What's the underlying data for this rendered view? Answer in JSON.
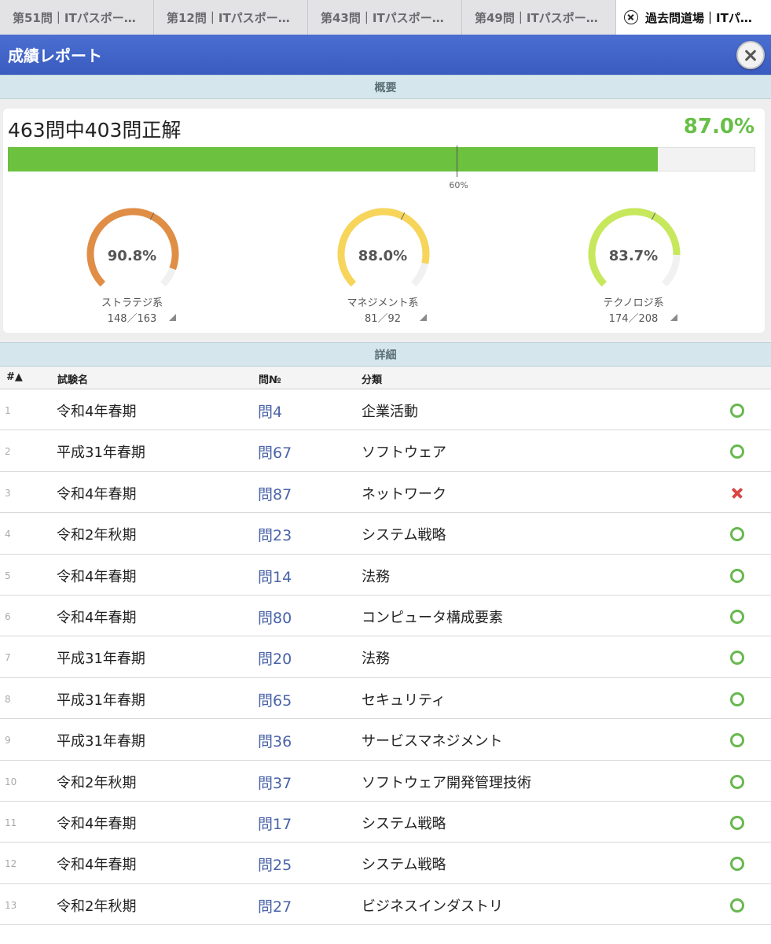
{
  "tabs": [
    {
      "label": "第51問｜ITパスポー…"
    },
    {
      "label": "第12問｜ITパスポー…"
    },
    {
      "label": "第43問｜ITパスポー…"
    },
    {
      "label": "第49問｜ITパスポー…"
    },
    {
      "label": "過去問道場｜ITパ…",
      "active": true
    }
  ],
  "header": {
    "title": "成績レポート"
  },
  "summary": {
    "section_label": "概要",
    "score_text": "463問中403問正解",
    "score_percent": "87.0%",
    "progress": 0.87,
    "pass_line": 0.6,
    "pass_line_label": "60%",
    "colors": {
      "bar": "#6cc13f",
      "percent": "#67bf46"
    }
  },
  "gauges": [
    {
      "pct_label": "90.8%",
      "value": 0.908,
      "name": "ストラテジ系",
      "count": "148／163",
      "color": "#e08d45"
    },
    {
      "pct_label": "88.0%",
      "value": 0.88,
      "name": "マネジメント系",
      "count": "81／92",
      "color": "#f6d55a"
    },
    {
      "pct_label": "83.7%",
      "value": 0.837,
      "name": "テクノロジ系",
      "count": "174／208",
      "color": "#c7e85c"
    }
  ],
  "details": {
    "section_label": "詳細",
    "columns": {
      "num": "#▲",
      "exam": "試験名",
      "q": "問№",
      "cat": "分類"
    },
    "rows": [
      {
        "num": "1",
        "exam": "令和4年春期",
        "q": "問4",
        "cat": "企業活動",
        "result": "correct"
      },
      {
        "num": "2",
        "exam": "平成31年春期",
        "q": "問67",
        "cat": "ソフトウェア",
        "result": "correct"
      },
      {
        "num": "3",
        "exam": "令和4年春期",
        "q": "問87",
        "cat": "ネットワーク",
        "result": "wrong"
      },
      {
        "num": "4",
        "exam": "令和2年秋期",
        "q": "問23",
        "cat": "システム戦略",
        "result": "correct"
      },
      {
        "num": "5",
        "exam": "令和4年春期",
        "q": "問14",
        "cat": "法務",
        "result": "correct"
      },
      {
        "num": "6",
        "exam": "令和4年春期",
        "q": "問80",
        "cat": "コンピュータ構成要素",
        "result": "correct"
      },
      {
        "num": "7",
        "exam": "平成31年春期",
        "q": "問20",
        "cat": "法務",
        "result": "correct"
      },
      {
        "num": "8",
        "exam": "平成31年春期",
        "q": "問65",
        "cat": "セキュリティ",
        "result": "correct"
      },
      {
        "num": "9",
        "exam": "平成31年春期",
        "q": "問36",
        "cat": "サービスマネジメント",
        "result": "correct"
      },
      {
        "num": "10",
        "exam": "令和2年秋期",
        "q": "問37",
        "cat": "ソフトウェア開発管理技術",
        "result": "correct"
      },
      {
        "num": "11",
        "exam": "令和4年春期",
        "q": "問17",
        "cat": "システム戦略",
        "result": "correct"
      },
      {
        "num": "12",
        "exam": "令和4年春期",
        "q": "問25",
        "cat": "システム戦略",
        "result": "correct"
      },
      {
        "num": "13",
        "exam": "令和2年秋期",
        "q": "問27",
        "cat": "ビジネスインダストリ",
        "result": "correct"
      }
    ]
  }
}
